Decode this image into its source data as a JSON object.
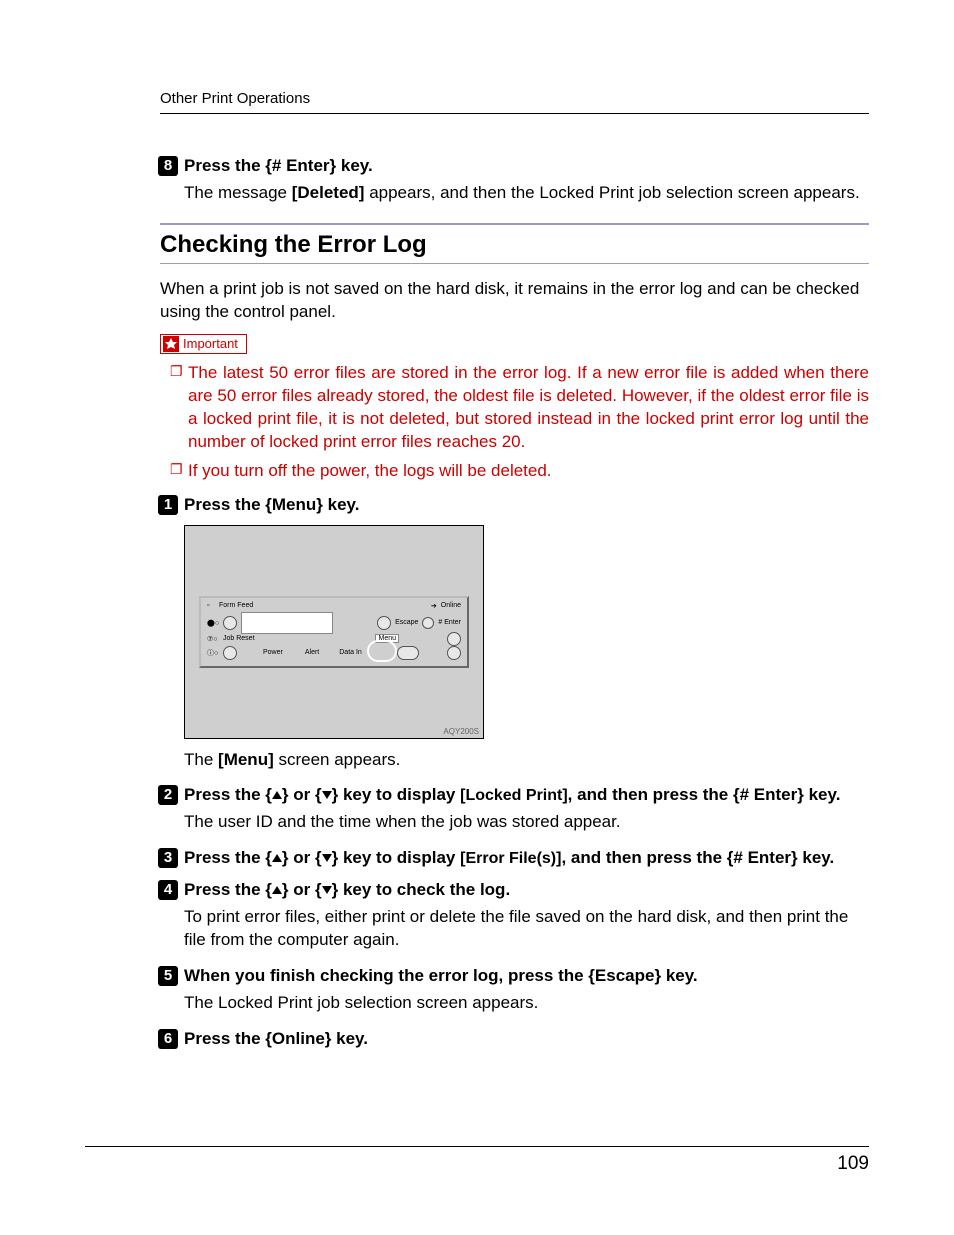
{
  "header": {
    "section_title": "Other Print Operations"
  },
  "page_number": "109",
  "step8": {
    "num": "8",
    "heading_prefix": "Press the ",
    "heading_key": "# Enter",
    "heading_suffix": " key.",
    "body_1": "The message ",
    "body_msg": "[Deleted]",
    "body_2": " appears, and then the Locked Print job selection screen appears."
  },
  "section": {
    "title": "Checking the Error Log",
    "intro": "When a print job is not saved on the hard disk, it remains in the error log and can be checked using the control panel.",
    "important_label": "Important",
    "important_items": [
      "The latest 50 error files are stored in the error log. If a new error file is added when there are 50 error files already stored, the oldest file is deleted. However, if the oldest error file is a locked print file, it is not deleted, but stored instead in the locked print error log until the number of locked print error files reaches 20.",
      "If you turn off the power, the logs will be deleted."
    ]
  },
  "figure": {
    "code": "AQY200S",
    "labels": {
      "online": "Online",
      "escape": "Escape",
      "enter": "# Enter",
      "menu": "Menu",
      "form_feed": "Form Feed",
      "job_reset": "Job Reset",
      "power": "Power",
      "alert": "Alert",
      "data_in": "Data In"
    }
  },
  "step1": {
    "num": "1",
    "heading_prefix": "Press the ",
    "heading_key": "Menu",
    "heading_suffix": " key.",
    "body_1": "The ",
    "body_msg": "[Menu]",
    "body_2": " screen appears."
  },
  "step2": {
    "num": "2",
    "heading_1": "Press the ",
    "heading_2": " or ",
    "heading_3": " key to display ",
    "heading_msg": "[Locked Print]",
    "heading_4": ", and then press the ",
    "heading_key2": "# Enter",
    "heading_5": " key.",
    "body": "The user ID and the time when the job was stored appear."
  },
  "step3": {
    "num": "3",
    "heading_1": "Press the ",
    "heading_2": " or ",
    "heading_3": " key to display ",
    "heading_msg": "[Error File(s)]",
    "heading_4": ", and then press the ",
    "heading_key2": "# Enter",
    "heading_5": " key."
  },
  "step4": {
    "num": "4",
    "heading_1": "Press the ",
    "heading_2": " or ",
    "heading_3": " key to check the log.",
    "body": "To print error files, either print or delete the file saved on the hard disk, and then print the file from the computer again."
  },
  "step5": {
    "num": "5",
    "heading_1": "When you finish checking the error log, press the ",
    "heading_key": "Escape",
    "heading_2": " key.",
    "body": "The Locked Print job selection screen appears."
  },
  "step6": {
    "num": "6",
    "heading_prefix": "Press the ",
    "heading_key": "Online",
    "heading_suffix": " key."
  }
}
